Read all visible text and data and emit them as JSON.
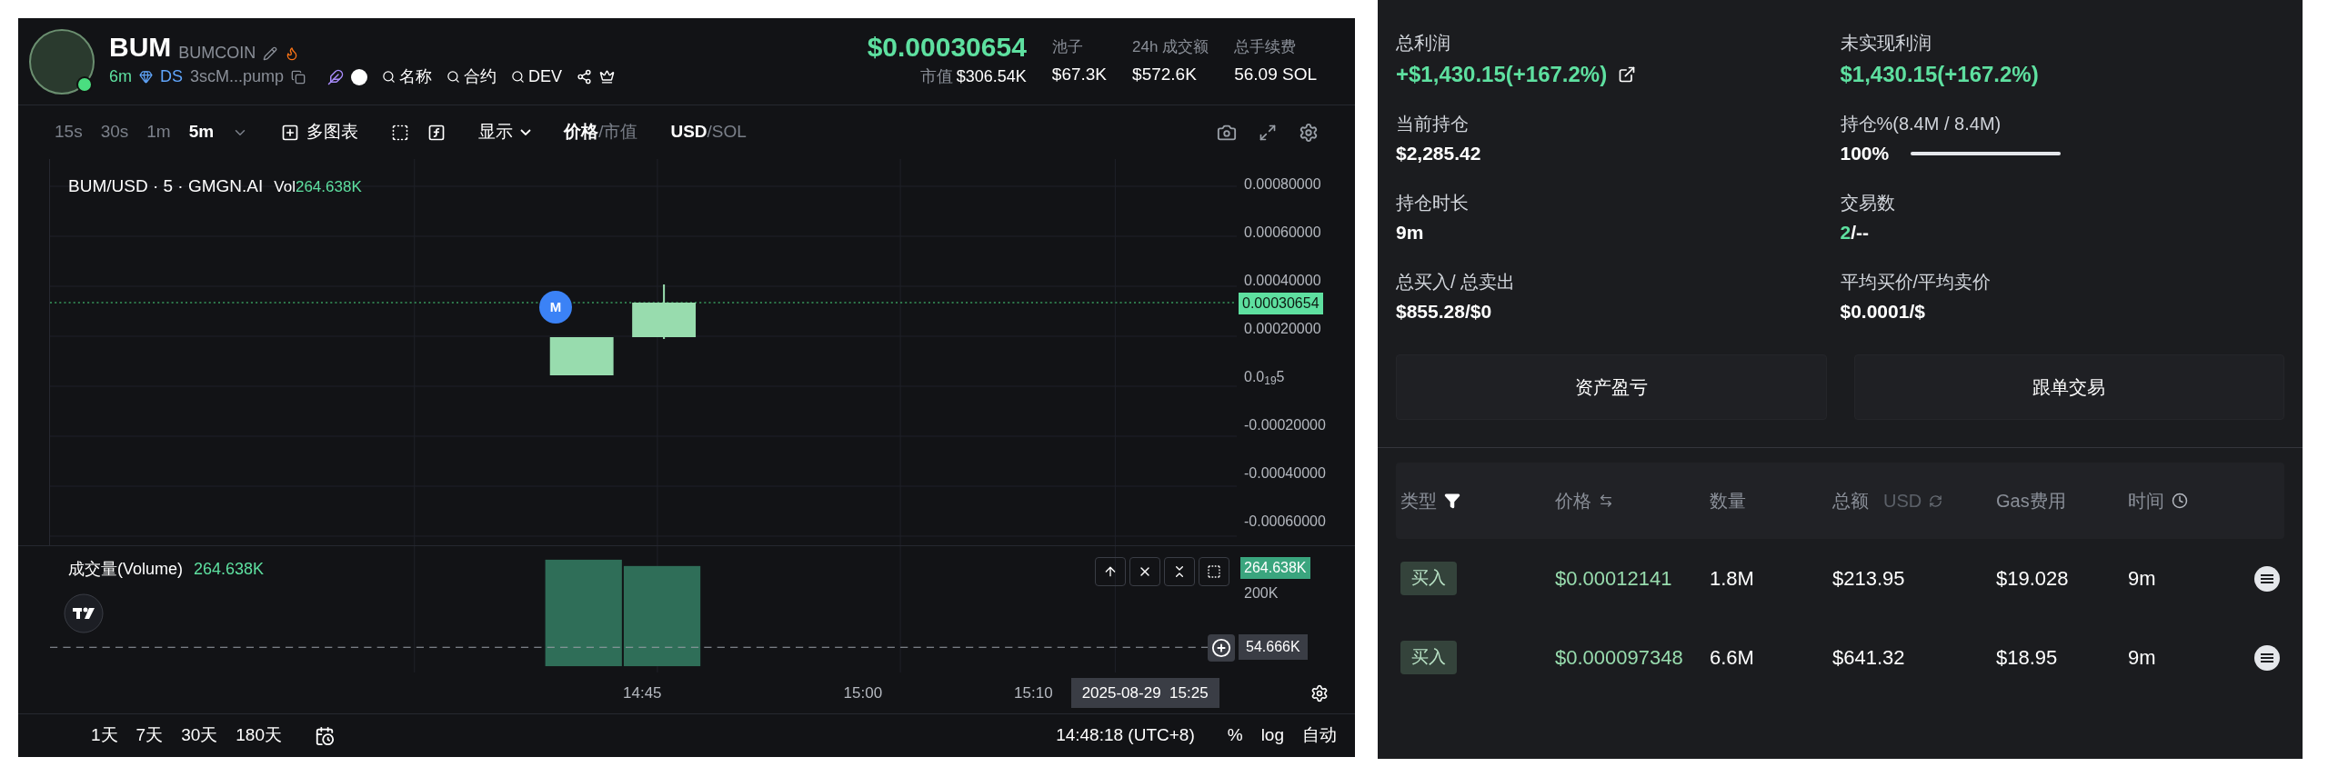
{
  "token_header": {
    "symbol": "BUM",
    "name": "BUMCOIN",
    "age": "6m",
    "dex": "DS",
    "address": "3scM...pump",
    "searches": [
      "名称",
      "合约",
      "DEV"
    ],
    "price": "$0.00030654",
    "market_cap_label": "市值",
    "market_cap": "$306.54K",
    "stats": [
      {
        "label": "池子",
        "value": "$67.3K"
      },
      {
        "label": "24h 成交额",
        "value": "$572.6K"
      },
      {
        "label": "总手续费",
        "value": "56.09 SOL"
      }
    ]
  },
  "chart_toolbar": {
    "intervals": [
      {
        "label": "15s",
        "selected": false
      },
      {
        "label": "30s",
        "selected": false
      },
      {
        "label": "1m",
        "selected": false
      },
      {
        "label": "5m",
        "selected": true
      }
    ],
    "multi_chart": "多图表",
    "display": "显示",
    "separator": "/",
    "price_mode": [
      {
        "label": "价格",
        "selected": true
      },
      {
        "label": "市值",
        "selected": false
      }
    ],
    "currency": [
      {
        "label": "USD",
        "selected": true
      },
      {
        "label": "SOL",
        "selected": false
      }
    ]
  },
  "chart": {
    "legend": "BUM/USD · 5 · GMGN.AI",
    "volume_label": "Vol",
    "volume_value": "264.638K",
    "price_axis": [
      "0.00080000",
      "0.00060000",
      "0.00040000",
      "0.00020000",
      "0.0$_{19}$5",
      "-0.00020000",
      "-0.00040000",
      "-0.00060000"
    ],
    "last_price": "0.00030654",
    "marker": "M",
    "volume_pane": {
      "title": "成交量(Volume)",
      "value": "264.638K",
      "axis_labels": [
        "264.638K",
        "200K"
      ],
      "crosshair_value": "54.666K"
    },
    "time_axis": [
      "14:45",
      "15:00",
      "15:10"
    ],
    "crosshair_time": "2025-08-29  15:25"
  },
  "bottom_bar": {
    "ranges": [
      "1天",
      "7天",
      "30天",
      "180天"
    ],
    "clock": "14:48:18 (UTC+8)",
    "options": [
      "%",
      "log",
      "自动"
    ]
  },
  "position": {
    "stats": [
      {
        "label": "总利润",
        "value": "+$1,430.15(+167.2%)",
        "kind": "profit",
        "link": true
      },
      {
        "label": "未实现利润",
        "value": "$1,430.15(+167.2%)",
        "kind": "profit"
      },
      {
        "label": "当前持仓",
        "value": "$2,285.42",
        "kind": "plain"
      },
      {
        "label": "持仓%(8.4M / 8.4M)",
        "value": "100%",
        "kind": "bar",
        "level": 1
      },
      {
        "label": "持仓时长",
        "value": "9m",
        "kind": "plain"
      },
      {
        "label": "交易数",
        "value": "2",
        "rest": "/--",
        "kind": "split"
      },
      {
        "label": "总买入/ 总卖出",
        "value": "$855.28/$0",
        "kind": "plain"
      },
      {
        "label": "平均买价/平均卖价",
        "value": "$0.0001/$",
        "kind": "plain"
      }
    ],
    "buttons": [
      "资产盈亏",
      "跟单交易"
    ]
  },
  "trades": {
    "columns": [
      {
        "label": "类型",
        "kind": "filter"
      },
      {
        "label": "价格",
        "kind": "sort"
      },
      {
        "label": "数量",
        "kind": "plain"
      },
      {
        "label": "总额",
        "kind": "currency",
        "unit": "USD"
      },
      {
        "label": "Gas费用",
        "kind": "plain"
      },
      {
        "label": "时间",
        "kind": "time"
      }
    ],
    "rows": [
      {
        "type": "买入",
        "price": "$0.00012141",
        "amount": "1.8M",
        "total": "$213.95",
        "gas": "$19.028",
        "time": "9m"
      },
      {
        "type": "买入",
        "price": "$0.000097348",
        "amount": "6.6M",
        "total": "$641.32",
        "gas": "$18.95",
        "time": "9m"
      }
    ]
  }
}
